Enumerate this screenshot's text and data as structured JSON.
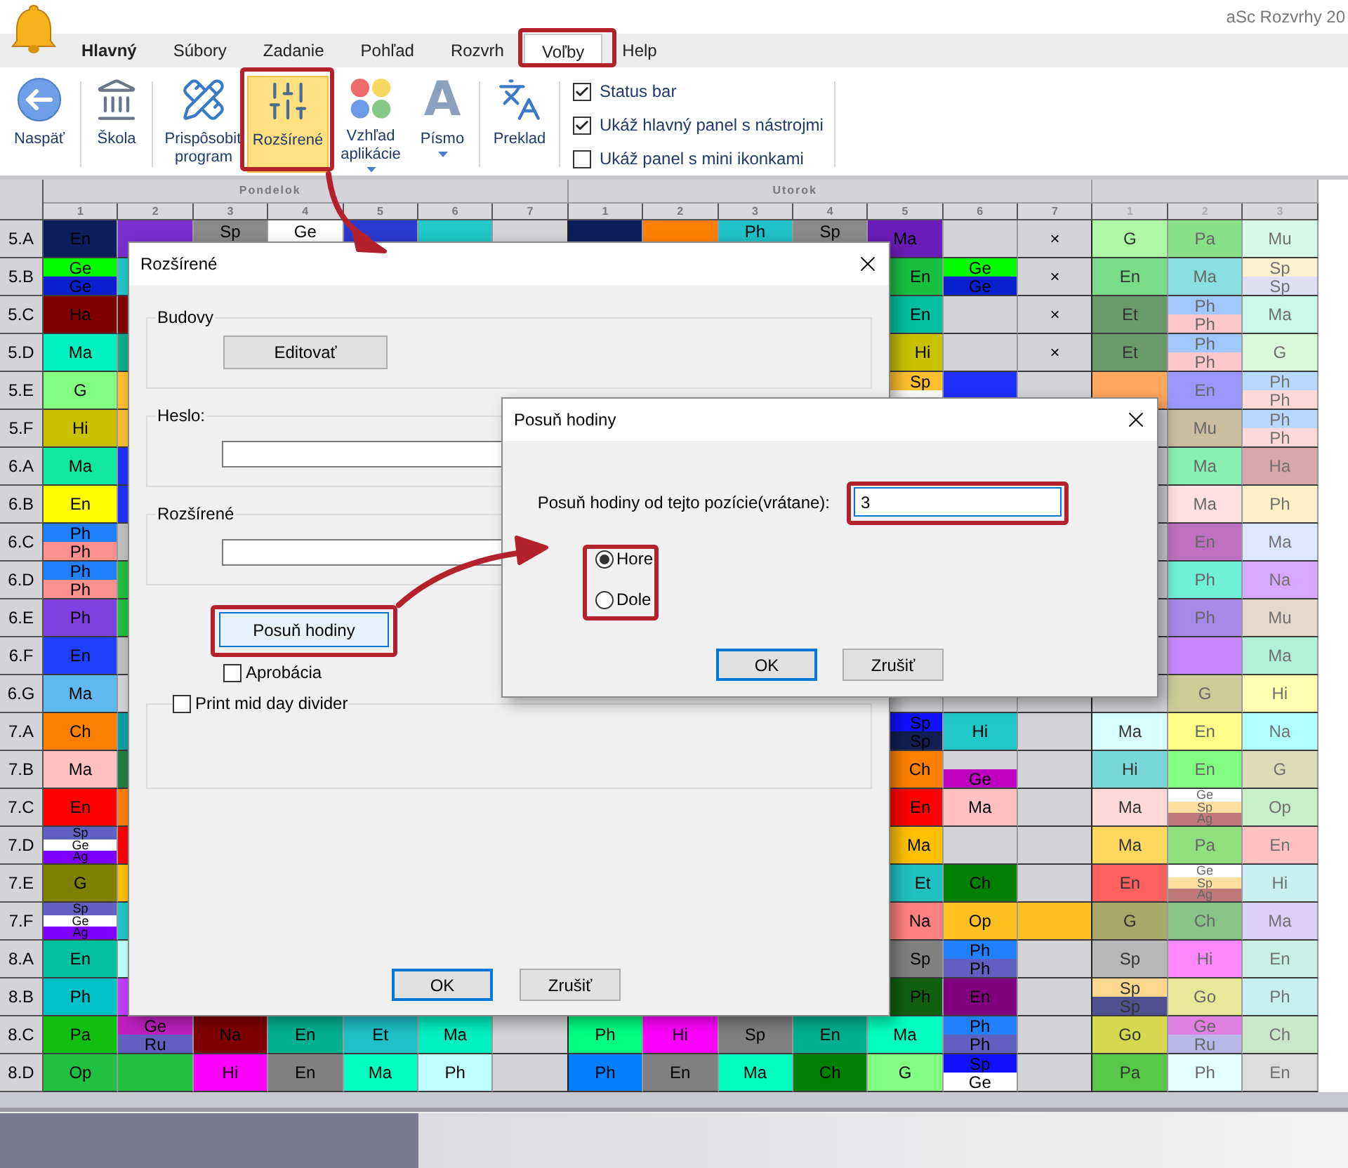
{
  "app": {
    "title": "aSc Rozvrhy 20"
  },
  "menu_tabs": [
    {
      "label": "Hlavný",
      "kind": "app",
      "selected": false
    },
    {
      "label": "Súbory",
      "kind": "tab",
      "selected": false
    },
    {
      "label": "Zadanie",
      "kind": "tab",
      "selected": false
    },
    {
      "label": "Pohľad",
      "kind": "tab",
      "selected": false
    },
    {
      "label": "Rozvrh",
      "kind": "tab",
      "selected": false
    },
    {
      "label": "Voľby",
      "kind": "tab",
      "selected": true
    },
    {
      "label": "Help",
      "kind": "tab",
      "selected": false
    }
  ],
  "ribbon": {
    "buttons": [
      {
        "label": "Naspäť",
        "selected": false,
        "dropdown": false
      },
      {
        "label": "Škola",
        "selected": false,
        "dropdown": false
      },
      {
        "label": "Prispôsobiť program",
        "selected": false,
        "dropdown": false
      },
      {
        "label": "Rozšírené",
        "selected": true,
        "dropdown": false
      },
      {
        "label": "Vzhľad aplikácie",
        "selected": false,
        "dropdown": true
      },
      {
        "label": "Písmo",
        "selected": false,
        "dropdown": true,
        "glyph": "A"
      },
      {
        "label": "Preklad",
        "selected": false,
        "dropdown": false
      }
    ],
    "checkboxes": [
      {
        "label": "Status bar",
        "checked": true
      },
      {
        "label": "Ukáž hlavný panel s nástrojmi",
        "checked": true
      },
      {
        "label": "Ukáž panel s mini ikonkami",
        "checked": false
      }
    ]
  },
  "timetable": {
    "days": [
      {
        "name": "Pondelok",
        "periods": [
          "1",
          "2",
          "3",
          "4",
          "5",
          "6",
          "7"
        ]
      },
      {
        "name": "Utorok",
        "periods": [
          "1",
          "2",
          "3",
          "4",
          "5",
          "6",
          "7"
        ]
      },
      {
        "periods": [
          "1",
          "2",
          "3"
        ]
      }
    ],
    "rows": [
      {
        "label": "5.A",
        "cells": [
          {
            "text": "En",
            "color": "#0c1f5c"
          },
          {
            "color": "#7a2fd0"
          },
          {
            "text": "Sp",
            "color": "#8a8a8a"
          },
          {
            "text": "Ge",
            "color": "#ffffff"
          },
          {
            "color": "#2a3ad0"
          },
          {
            "color": "#20c8c8"
          },
          {
            "color": "#d4d4d8"
          },
          {
            "color": "#0c1f5c"
          },
          {
            "color": "#ff8000"
          },
          {
            "text": "Ph",
            "color": "#20c0c8"
          },
          {
            "text": "Sp",
            "color": "#8a8a8a"
          },
          {
            "text": "Ma",
            "color": "#6a1cb8"
          },
          {
            "color": "#d4d4d8"
          },
          {
            "text": "×",
            "color": "#d4d4d8"
          },
          {
            "text": "G",
            "color": "#b0f8a8"
          },
          {
            "text": "Pa",
            "color": "#88e088"
          },
          {
            "text": "Mu",
            "color": "#d8faea"
          }
        ]
      },
      {
        "label": "5.B",
        "cells": [
          {
            "parts": [
              {
                "text": "Ge",
                "color": "#00ff00"
              },
              {
                "text": "Ge",
                "color": "#0820d0"
              }
            ]
          },
          {
            "color": "#20c8c8"
          },
          null,
          null,
          null,
          null,
          null,
          null,
          null,
          null,
          null,
          {
            "text": "En",
            "color": "#18c040"
          },
          {
            "parts": [
              {
                "text": "Ge",
                "color": "#00ff00"
              },
              {
                "text": "Ge",
                "color": "#0820d0"
              }
            ]
          },
          {
            "text": "×",
            "color": "#d4d4d8"
          },
          {
            "text": "En",
            "color": "#78dc88"
          },
          {
            "text": "Ma",
            "color": "#88e0e0"
          },
          {
            "parts": [
              {
                "text": "Sp",
                "color": "#fff0d0"
              },
              {
                "text": "Sp",
                "color": "#e0e0f4"
              }
            ]
          }
        ]
      },
      {
        "label": "5.C",
        "cells": [
          {
            "text": "Ha",
            "color": "#800000"
          },
          {
            "color": "#800000"
          },
          null,
          null,
          null,
          null,
          null,
          null,
          null,
          null,
          null,
          {
            "text": "En",
            "color": "#00c0a0"
          },
          {
            "color": "#d4d4d8"
          },
          {
            "text": "×",
            "color": "#d4d4d8"
          },
          {
            "text": "Et",
            "color": "#6a9a6a"
          },
          {
            "parts": [
              {
                "text": "Ph",
                "color": "#a0c8ff"
              },
              {
                "text": "Ph",
                "color": "#ffc8c8"
              }
            ]
          },
          {
            "text": "Ma",
            "color": "#c8f8e8"
          }
        ]
      },
      {
        "label": "5.D",
        "cells": [
          {
            "text": "Ma",
            "color": "#00f0c0"
          },
          {
            "color": "#10b090"
          },
          null,
          null,
          null,
          null,
          null,
          null,
          null,
          null,
          null,
          {
            "text": "Hi",
            "color": "#c8c000"
          },
          {
            "color": "#d4d4d8"
          },
          {
            "text": "×",
            "color": "#d4d4d8"
          },
          {
            "text": "Et",
            "color": "#6a9a6a"
          },
          {
            "parts": [
              {
                "text": "Ph",
                "color": "#a0c8ff"
              },
              {
                "text": "Ph",
                "color": "#ffc8c8"
              }
            ]
          },
          {
            "text": "G",
            "color": "#d8f8d8"
          }
        ]
      },
      {
        "label": "5.E",
        "cells": [
          {
            "text": "G",
            "color": "#80ff80"
          },
          {
            "color": "#ffc030"
          },
          null,
          null,
          null,
          null,
          null,
          null,
          null,
          null,
          null,
          {
            "parts": [
              {
                "text": "Sp",
                "color": "#ffc030"
              },
              {
                "color": "#ffffff"
              }
            ]
          },
          {
            "color": "#2030ff"
          },
          {
            "color": "#d4d4d8"
          },
          {
            "color": "#ffa860"
          },
          {
            "text": "En",
            "color": "#9898ff"
          },
          {
            "parts": [
              {
                "text": "Ph",
                "color": "#b8d8ff"
              },
              {
                "text": "Ph",
                "color": "#ffd8d8"
              }
            ]
          }
        ]
      },
      {
        "label": "5.F",
        "cells": [
          {
            "text": "Hi",
            "color": "#c8c000"
          },
          {
            "color": "#ffc030"
          },
          null,
          null,
          null,
          null,
          null,
          null,
          null,
          null,
          null,
          null,
          null,
          null,
          null,
          {
            "text": "Mu",
            "color": "#ccbca0"
          },
          {
            "parts": [
              {
                "text": "Ph",
                "color": "#b8d8ff"
              },
              {
                "text": "Ph",
                "color": "#ffd8d8"
              }
            ]
          }
        ]
      },
      {
        "label": "6.A",
        "cells": [
          {
            "text": "Ma",
            "color": "#10e8a0"
          },
          {
            "color": "#2030ff"
          },
          null,
          null,
          null,
          null,
          null,
          null,
          null,
          null,
          null,
          null,
          null,
          null,
          null,
          {
            "text": "Ma",
            "color": "#88f0b0"
          },
          {
            "text": "Ha",
            "color": "#d8a8a8"
          }
        ]
      },
      {
        "label": "6.B",
        "cells": [
          {
            "text": "En",
            "color": "#ffff00"
          },
          {
            "color": "#2030ff"
          },
          null,
          null,
          null,
          null,
          null,
          null,
          null,
          null,
          null,
          null,
          null,
          null,
          null,
          {
            "text": "Ma",
            "color": "#ffe0e0"
          },
          {
            "text": "Ph",
            "color": "#fff0c8"
          }
        ]
      },
      {
        "label": "6.C",
        "cells": [
          {
            "parts": [
              {
                "text": "Ph",
                "color": "#2080ff"
              },
              {
                "text": "Ph",
                "color": "#ff9090"
              }
            ]
          },
          {
            "color": "#c0c0c0"
          },
          null,
          null,
          null,
          null,
          null,
          null,
          null,
          null,
          null,
          null,
          null,
          null,
          null,
          {
            "text": "En",
            "color": "#c070c0"
          },
          {
            "text": "Ma",
            "color": "#dce8ff"
          }
        ]
      },
      {
        "label": "6.D",
        "cells": [
          {
            "parts": [
              {
                "text": "Ph",
                "color": "#2080ff"
              },
              {
                "text": "Ph",
                "color": "#ff9090"
              }
            ]
          },
          {
            "color": "#20c040"
          },
          null,
          null,
          null,
          null,
          null,
          null,
          null,
          null,
          null,
          null,
          null,
          null,
          null,
          {
            "text": "Ph",
            "color": "#70f0d8"
          },
          {
            "text": "Na",
            "color": "#d8a8ff"
          }
        ]
      },
      {
        "label": "6.E",
        "cells": [
          {
            "text": "Ph",
            "color": "#8040e0"
          },
          {
            "color": "#20c040"
          },
          null,
          null,
          null,
          null,
          null,
          null,
          null,
          null,
          null,
          null,
          null,
          null,
          null,
          {
            "text": "Ph",
            "color": "#a888e8"
          },
          {
            "text": "Mu",
            "color": "#e4d8c8"
          }
        ]
      },
      {
        "label": "6.F",
        "cells": [
          {
            "text": "En",
            "color": "#2040ff"
          },
          {
            "color": "#c0c0c0"
          },
          null,
          null,
          null,
          null,
          null,
          null,
          null,
          null,
          null,
          null,
          null,
          null,
          null,
          {
            "color": "#c888ff"
          },
          {
            "text": "Ma",
            "color": "#b0f0d8"
          }
        ]
      },
      {
        "label": "6.G",
        "cells": [
          {
            "text": "Ma",
            "color": "#60b8f0"
          },
          {
            "color": "#d4d4d8"
          },
          null,
          null,
          null,
          null,
          null,
          null,
          null,
          null,
          null,
          null,
          null,
          null,
          null,
          {
            "text": "G",
            "color": "#cccc98"
          },
          {
            "text": "Hi",
            "color": "#ffffb0"
          }
        ]
      },
      {
        "label": "7.A",
        "cells": [
          {
            "text": "Ch",
            "color": "#ff8000"
          },
          {
            "color": "#10a0a0"
          },
          null,
          null,
          null,
          null,
          null,
          null,
          null,
          null,
          null,
          {
            "parts": [
              {
                "text": "Sp",
                "color": "#1010ff"
              },
              {
                "text": "Sp",
                "color": "#102050"
              }
            ]
          },
          {
            "text": "Hi",
            "color": "#20c8c8"
          },
          {
            "color": "#d4d4d8"
          },
          {
            "text": "Ma",
            "color": "#d8ffff"
          },
          {
            "text": "En",
            "color": "#ffff88"
          },
          {
            "text": "Na",
            "color": "#b0ffff"
          }
        ]
      },
      {
        "label": "7.B",
        "cells": [
          {
            "text": "Ma",
            "color": "#ffc0c0"
          },
          {
            "color": "#208040"
          },
          null,
          null,
          null,
          null,
          null,
          null,
          null,
          null,
          null,
          {
            "text": "Ch",
            "color": "#ff8000"
          },
          {
            "parts": [
              {
                "color": "#d4d4d8"
              },
              {
                "text": "Ge",
                "color": "#c000c0"
              }
            ]
          },
          {
            "color": "#d4d4d8"
          },
          {
            "text": "Hi",
            "color": "#78d8d8"
          },
          {
            "text": "En",
            "color": "#80ff80"
          },
          {
            "text": "G",
            "color": "#dcdcb8"
          }
        ]
      },
      {
        "label": "7.C",
        "cells": [
          {
            "text": "En",
            "color": "#ff0000"
          },
          {
            "color": "#ff8000"
          },
          null,
          null,
          null,
          null,
          null,
          null,
          null,
          null,
          null,
          {
            "text": "En",
            "color": "#ff0000"
          },
          {
            "text": "Ma",
            "color": "#ffc0c0"
          },
          {
            "color": "#d4d4d8"
          },
          {
            "text": "Ma",
            "color": "#ffd8d8"
          },
          {
            "parts": [
              {
                "text": "Ge",
                "color": "#ffffff"
              },
              {
                "text": "Sp",
                "color": "#ffe0a0"
              },
              {
                "text": "Ag",
                "color": "#c07878"
              }
            ]
          },
          {
            "text": "Op",
            "color": "#c8f0c8"
          }
        ]
      },
      {
        "label": "7.D",
        "cells": [
          {
            "parts": [
              {
                "text": "Sp",
                "color": "#6060c0"
              },
              {
                "text": "Ge",
                "color": "#ffffff"
              },
              {
                "text": "Ag",
                "color": "#8000ff"
              }
            ]
          },
          {
            "color": "#ff0000"
          },
          null,
          null,
          null,
          null,
          null,
          null,
          null,
          null,
          null,
          {
            "text": "Ma",
            "color": "#ffc000"
          },
          {
            "color": "#d4d4d8"
          },
          {
            "color": "#d4d4d8"
          },
          {
            "text": "Ma",
            "color": "#ffd860"
          },
          {
            "text": "Pa",
            "color": "#90e080"
          },
          {
            "text": "En",
            "color": "#ffc0c0"
          }
        ]
      },
      {
        "label": "7.E",
        "cells": [
          {
            "text": "G",
            "color": "#808000"
          },
          {
            "color": "#ffc000"
          },
          null,
          null,
          null,
          null,
          null,
          null,
          null,
          null,
          null,
          {
            "text": "Et",
            "color": "#20c0c0"
          },
          {
            "text": "Ch",
            "color": "#008000"
          },
          {
            "color": "#d4d4d8"
          },
          {
            "text": "En",
            "color": "#ff6060"
          },
          {
            "parts": [
              {
                "text": "Ge",
                "color": "#ffffff"
              },
              {
                "text": "Sp",
                "color": "#ffe0a0"
              },
              {
                "text": "Ag",
                "color": "#c07878"
              }
            ]
          },
          {
            "text": "Hi",
            "color": "#c8f0f0"
          }
        ]
      },
      {
        "label": "7.F",
        "cells": [
          {
            "parts": [
              {
                "text": "Sp",
                "color": "#6060c0"
              },
              {
                "text": "Ge",
                "color": "#ffffff"
              },
              {
                "text": "Ag",
                "color": "#8000ff"
              }
            ]
          },
          {
            "color": "#20c8c8"
          },
          null,
          null,
          null,
          null,
          null,
          null,
          null,
          null,
          null,
          {
            "text": "Na",
            "color": "#ff8080"
          },
          {
            "text": "Op",
            "color": "#ffc020"
          },
          {
            "color": "#ffc020"
          },
          {
            "text": "G",
            "color": "#a8a868"
          },
          {
            "text": "Ch",
            "color": "#88c488"
          },
          {
            "text": "Ma",
            "color": "#dcd0f8"
          }
        ]
      },
      {
        "label": "8.A",
        "cells": [
          {
            "text": "En",
            "color": "#00c0a0"
          },
          {
            "color": "#c0ffff"
          },
          null,
          null,
          null,
          null,
          null,
          null,
          null,
          null,
          null,
          {
            "text": "Sp",
            "color": "#808080"
          },
          {
            "parts": [
              {
                "text": "Ph",
                "color": "#2080ff"
              },
              {
                "text": "Ph",
                "color": "#6060c0"
              }
            ]
          },
          {
            "color": "#d4d4d8"
          },
          {
            "text": "Sp",
            "color": "#b8b8b8"
          },
          {
            "text": "Hi",
            "color": "#ff88ff"
          },
          {
            "text": "En",
            "color": "#c8f0e4"
          }
        ]
      },
      {
        "label": "8.B",
        "cells": [
          {
            "text": "Ph",
            "color": "#00c0c8"
          },
          {
            "color": "#c040ff"
          },
          null,
          null,
          null,
          null,
          null,
          null,
          null,
          null,
          null,
          {
            "text": "Ph",
            "color": "#106010"
          },
          {
            "text": "En",
            "color": "#800080"
          },
          {
            "color": "#d4d4d8"
          },
          {
            "parts": [
              {
                "text": "Sp",
                "color": "#ffd890"
              },
              {
                "text": "Sp",
                "color": "#505090"
              }
            ]
          },
          {
            "text": "Go",
            "color": "#e8e898"
          },
          {
            "text": "Ph",
            "color": "#c8f0f0"
          }
        ]
      },
      {
        "label": "8.C",
        "cells": [
          {
            "text": "Pa",
            "color": "#10c010"
          },
          {
            "parts": [
              {
                "text": "Ge",
                "color": "#c020c0"
              },
              {
                "text": "Ru",
                "color": "#6060c0"
              }
            ]
          },
          {
            "text": "Na",
            "color": "#800000"
          },
          {
            "text": "En",
            "color": "#00b090"
          },
          {
            "text": "Et",
            "color": "#20c0c8"
          },
          {
            "text": "Ma",
            "color": "#00f0c0"
          },
          {
            "color": "#d4d4d8"
          },
          {
            "text": "Ph",
            "color": "#00ff80"
          },
          {
            "text": "Hi",
            "color": "#ff00ff"
          },
          {
            "text": "Sp",
            "color": "#808080"
          },
          {
            "text": "En",
            "color": "#00b090"
          },
          {
            "text": "Ma",
            "color": "#00ffc0"
          },
          {
            "parts": [
              {
                "text": "Ph",
                "color": "#2080ff"
              },
              {
                "text": "Ph",
                "color": "#6060c0"
              }
            ]
          },
          {
            "color": "#d4d4d8"
          },
          {
            "text": "Go",
            "color": "#d8d850"
          },
          {
            "parts": [
              {
                "text": "Ge",
                "color": "#e080e0"
              },
              {
                "text": "Ru",
                "color": "#b8b8e8"
              }
            ]
          },
          {
            "text": "Ch",
            "color": "#c8e8c8"
          }
        ]
      },
      {
        "label": "8.D",
        "cells": [
          {
            "text": "Op",
            "color": "#20c040"
          },
          {
            "color": "#20c040"
          },
          {
            "text": "Hi",
            "color": "#ff00ff"
          },
          {
            "text": "En",
            "color": "#808080"
          },
          {
            "text": "Ma",
            "color": "#00ffc0"
          },
          {
            "text": "Ph",
            "color": "#c0ffff"
          },
          {
            "color": "#d4d4d8"
          },
          {
            "text": "Ph",
            "color": "#0080ff"
          },
          {
            "text": "En",
            "color": "#808080"
          },
          {
            "text": "Ma",
            "color": "#00ffc0"
          },
          {
            "text": "Ch",
            "color": "#008000"
          },
          {
            "text": "G",
            "color": "#80ff80"
          },
          {
            "parts": [
              {
                "text": "Sp",
                "color": "#1010ff"
              },
              {
                "text": "Ge",
                "color": "#ffffff"
              }
            ]
          },
          {
            "color": "#d4d4d8"
          },
          {
            "text": "Pa",
            "color": "#58c848"
          },
          {
            "text": "Ph",
            "color": "#e4ffff"
          },
          {
            "text": "En",
            "color": "#dcdcdc"
          }
        ]
      }
    ]
  },
  "advanced_dialog": {
    "title": "Rozšírené",
    "buildings": {
      "legend": "Budovy",
      "button": "Editovať"
    },
    "password": {
      "legend": "Heslo:"
    },
    "advanced": {
      "legend": "Rozšírené"
    },
    "shift_button": "Posuň hodiny",
    "approbation": {
      "label": "Aprobácia",
      "checked": false
    },
    "divider": {
      "label": "Print mid day divider",
      "checked": false
    },
    "buttons": [
      "OK",
      "Zrušiť"
    ]
  },
  "shift_dialog": {
    "title": "Posuň hodiny",
    "label": "Posuň hodiny od tejto pozície(vrátane):",
    "value": "3",
    "radios": [
      {
        "label": "Hore",
        "selected": true
      },
      {
        "label": "Dole",
        "selected": false
      }
    ],
    "buttons": [
      "OK",
      "Zrušiť"
    ]
  }
}
